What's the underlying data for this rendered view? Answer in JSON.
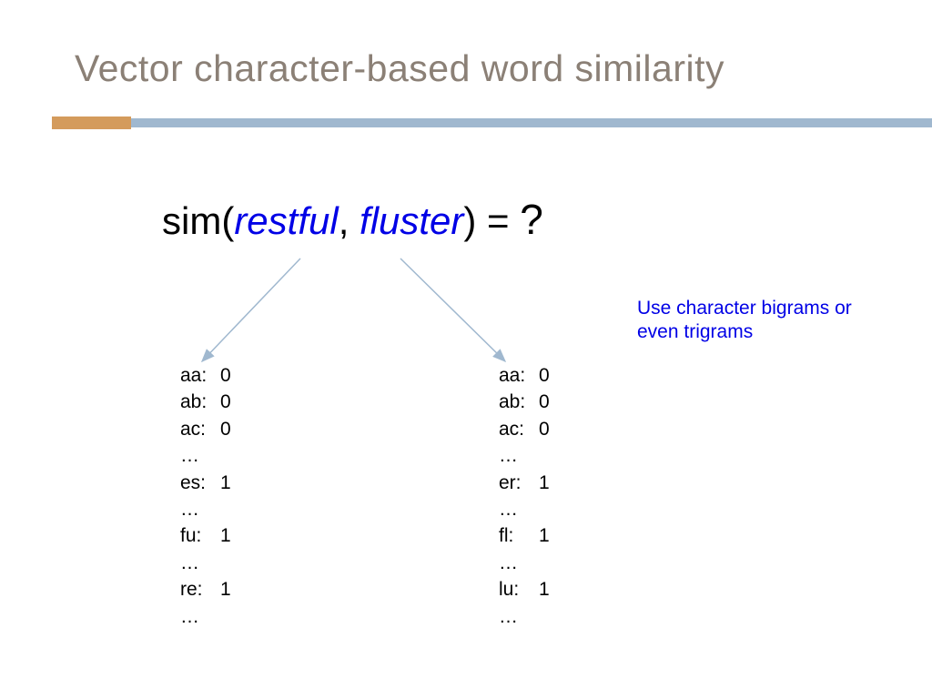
{
  "title": "Vector character-based word similarity",
  "formula": {
    "prefix": "sim(",
    "w1": "restful",
    "sep": ", ",
    "w2": "fluster",
    "suffix": ") = ",
    "result": "?"
  },
  "note": "Use character bigrams or even trigrams",
  "vector_left": [
    {
      "key": "aa:",
      "val": "0"
    },
    {
      "key": "ab:",
      "val": "0"
    },
    {
      "key": "ac:",
      "val": "0"
    },
    {
      "key": "…",
      "val": ""
    },
    {
      "key": "es:",
      "val": "1"
    },
    {
      "key": "…",
      "val": ""
    },
    {
      "key": "fu:",
      "val": "1"
    },
    {
      "key": "…",
      "val": ""
    },
    {
      "key": "re:",
      "val": "1"
    },
    {
      "key": "…",
      "val": ""
    }
  ],
  "vector_right": [
    {
      "key": "aa:",
      "val": "0"
    },
    {
      "key": "ab:",
      "val": "0"
    },
    {
      "key": "ac:",
      "val": "0"
    },
    {
      "key": "…",
      "val": ""
    },
    {
      "key": "er:",
      "val": "1"
    },
    {
      "key": "…",
      "val": ""
    },
    {
      "key": "fl:",
      "val": "1"
    },
    {
      "key": "…",
      "val": ""
    },
    {
      "key": "lu:",
      "val": "1"
    },
    {
      "key": "…",
      "val": ""
    }
  ]
}
